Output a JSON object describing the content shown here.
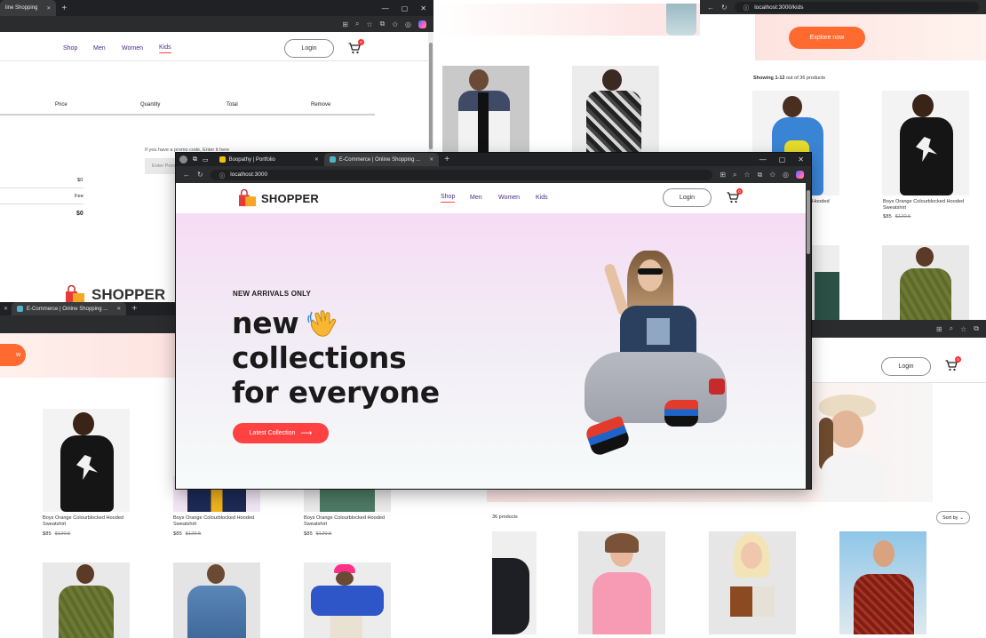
{
  "browser": {
    "tabs": {
      "shopping_short": "line Shopping",
      "portfolio": "Boopathy | Portfolio",
      "ecommerce": "E-Commerce | Online Shopping ...",
      "ecommerce_long": "E-Commerce | Online Shopping Website"
    },
    "urls": {
      "home": "localhost:3000",
      "kids": "localhost:3000/kids"
    }
  },
  "nav": {
    "shop": "Shop",
    "men": "Men",
    "women": "Women",
    "kids": "Kids",
    "login": "Login",
    "cart_count": "0"
  },
  "brand": {
    "name": "SHOPPER"
  },
  "cart_page": {
    "headers": [
      "Price",
      "Quantity",
      "Total",
      "Remove"
    ],
    "promo_text": "If you have a promo code, Enter it here",
    "promo_placeholder": "Enter Promo",
    "subtotal": "$0",
    "shipping": "Fee",
    "total": "$0"
  },
  "hero": {
    "eyebrow": "NEW ARRIVALS ONLY",
    "line1": "new",
    "line2": "collections",
    "line3": "for everyone",
    "button": "Latest Collection",
    "button_arrow": "⟶"
  },
  "kids_page": {
    "explore_button": "Explore now",
    "showing": "Showing 1-12",
    "showing_rest": " out of 36 products",
    "sort": "Sort by",
    "products_count": "36 products"
  },
  "product": {
    "name_line1": "Boys Orange Colourblocked Hooded",
    "name_line2": "Sweatshirt",
    "price": "$85",
    "old_price": "$120.5"
  },
  "partial": {
    "w_button": "w",
    "lauded": "Hooded"
  },
  "colors": {
    "accent": "#ff4141",
    "nav": "#4a2a8a",
    "hero_bg_top": "#f6dcf5",
    "hero_bg_bottom": "#f6fbfa",
    "chrome": "#202124"
  }
}
